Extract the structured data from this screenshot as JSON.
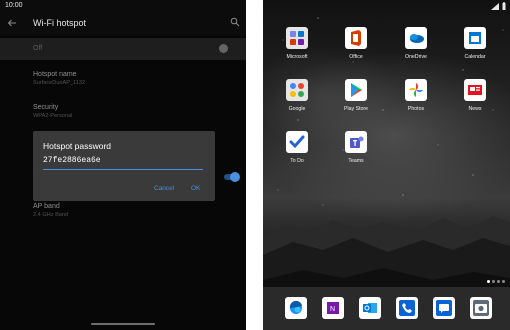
{
  "left_pane": {
    "status": {
      "time": "10:00"
    },
    "toolbar": {
      "title": "Wi-Fi hotspot",
      "back_icon": "arrow-back-icon",
      "search_icon": "search-icon"
    },
    "hotspot_toggle": {
      "label": "Off",
      "state": "off"
    },
    "settings": [
      {
        "key": "Hotspot name",
        "value": "SurfaceDuoAP_1132"
      },
      {
        "key": "Security",
        "value": "WPA2-Personal"
      },
      {
        "key": "AP band",
        "value": "2.4 GHz Band"
      }
    ],
    "dialog": {
      "title": "Hotspot password",
      "password_value": "27fe2886ea6e",
      "cancel_label": "Cancel",
      "ok_label": "OK"
    },
    "accent_color": "#4a8fe0"
  },
  "right_pane": {
    "apps": [
      {
        "label": "Microsoft",
        "icon": "microsoft-folder-icon"
      },
      {
        "label": "Office",
        "icon": "office-icon"
      },
      {
        "label": "OneDrive",
        "icon": "onedrive-icon"
      },
      {
        "label": "Calendar",
        "icon": "calendar-icon"
      },
      {
        "label": "Google",
        "icon": "google-folder-icon"
      },
      {
        "label": "Play Store",
        "icon": "play-store-icon"
      },
      {
        "label": "Photos",
        "icon": "photos-icon"
      },
      {
        "label": "News",
        "icon": "news-icon"
      },
      {
        "label": "To Do",
        "icon": "todo-icon"
      },
      {
        "label": "Teams",
        "icon": "teams-icon"
      }
    ],
    "dock": [
      "edge-icon",
      "onenote-icon",
      "outlook-icon",
      "phone-icon",
      "messages-icon",
      "camera-icon"
    ]
  }
}
